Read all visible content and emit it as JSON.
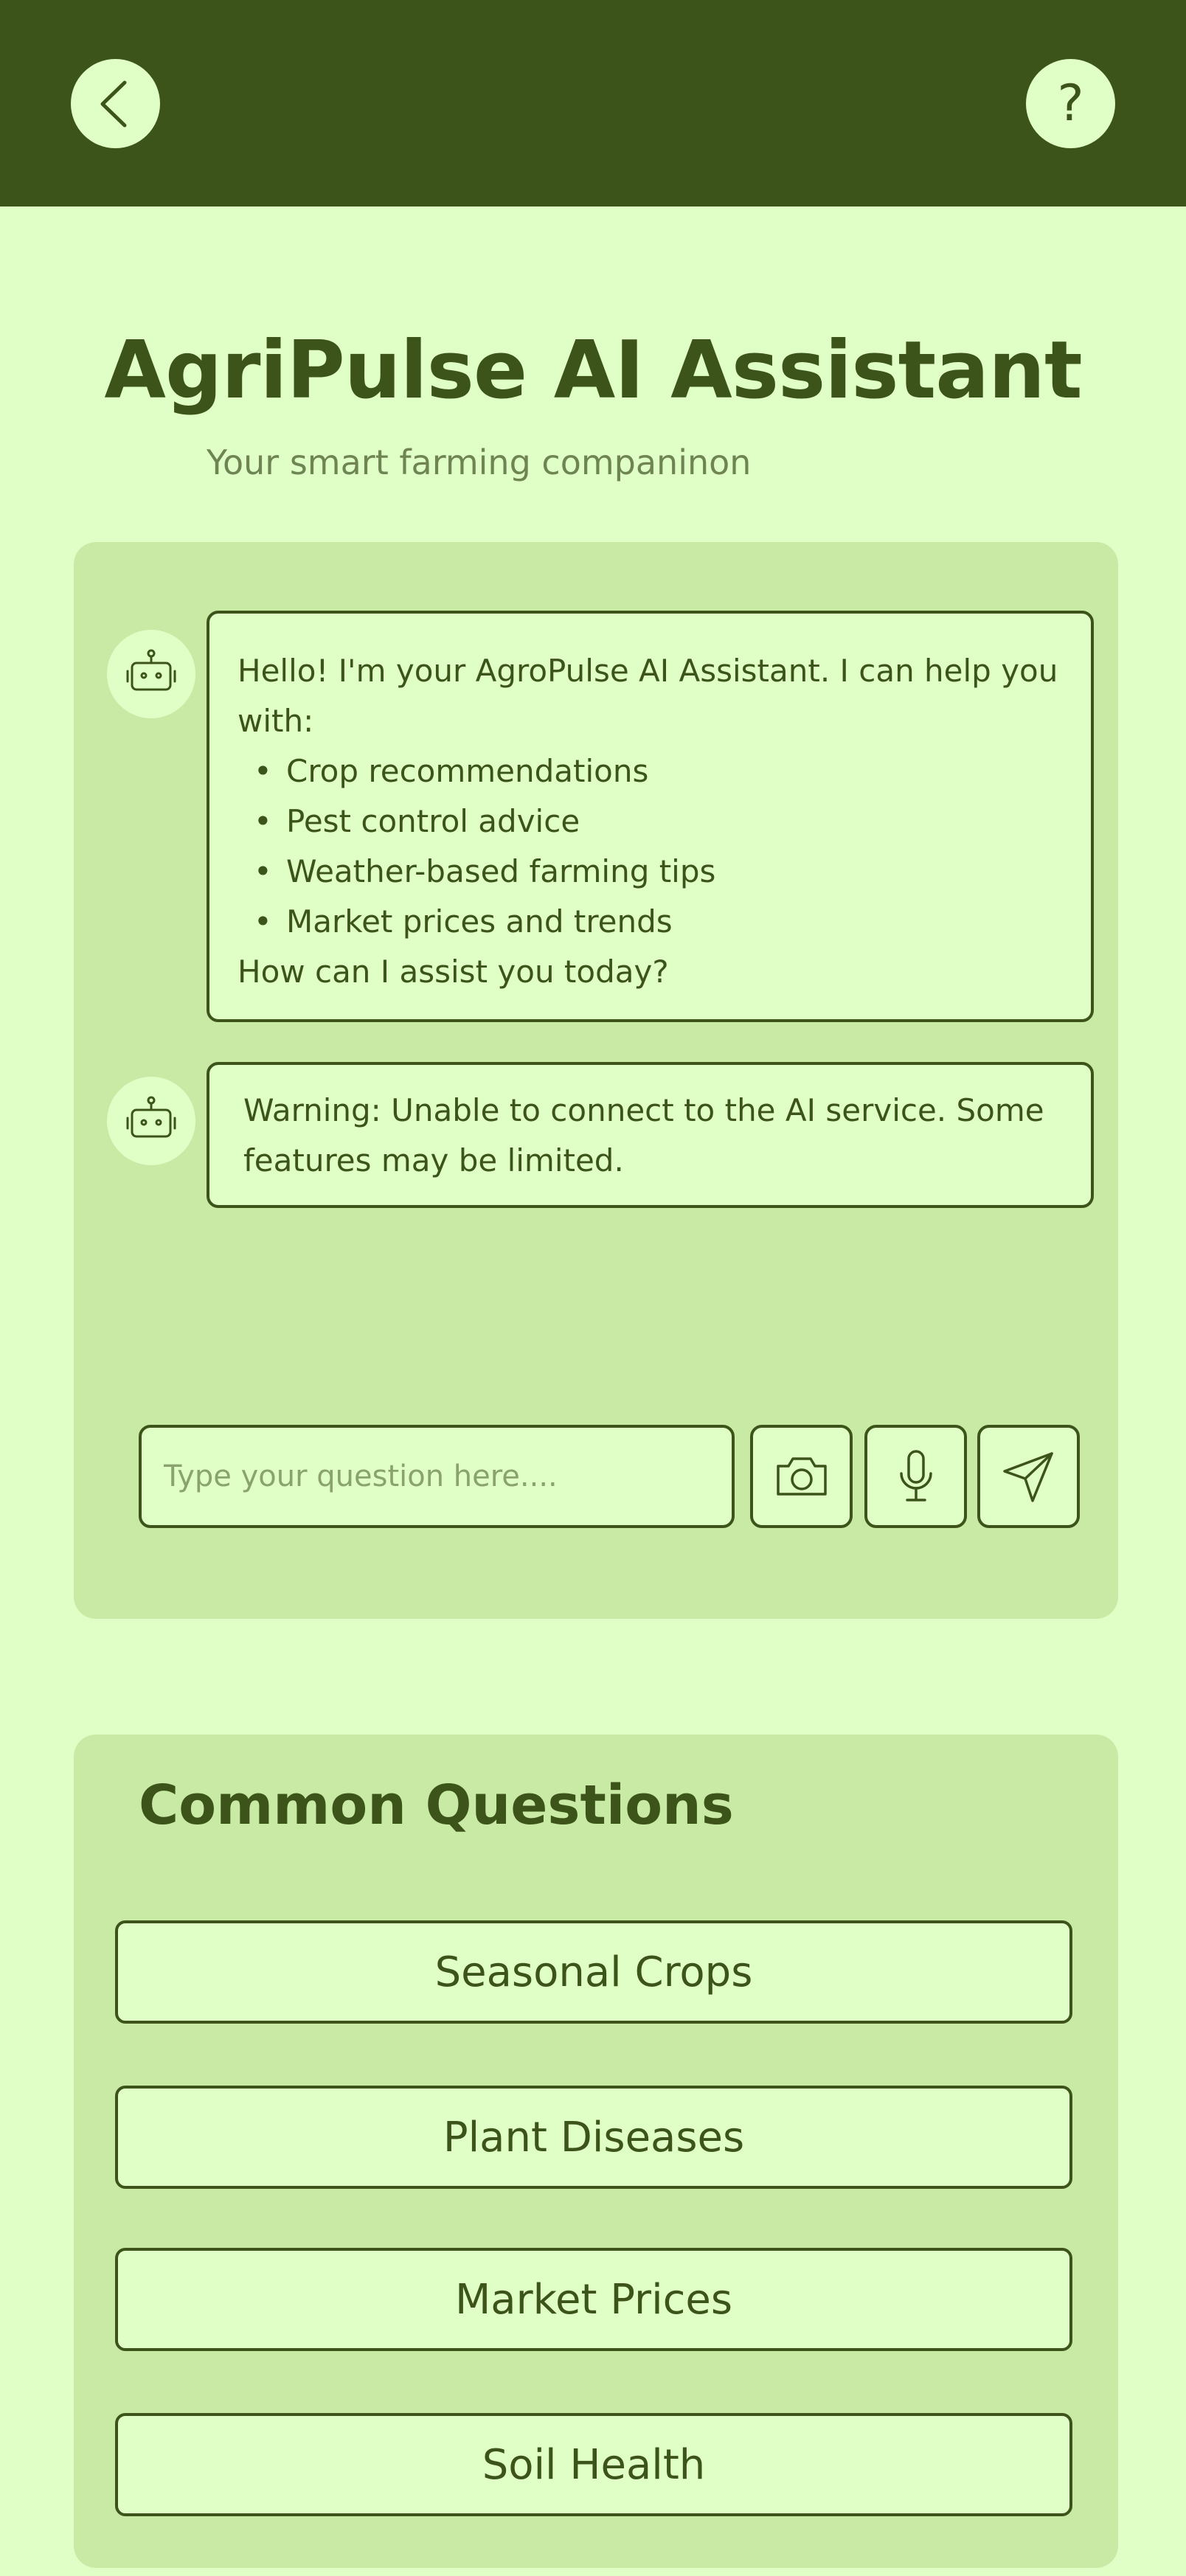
{
  "header": {
    "back_icon": "chevron-left-icon",
    "help_label": "?"
  },
  "hero": {
    "title": "AgriPulse AI Assistant",
    "subtitle": "Your smart farming companinon"
  },
  "chat": {
    "messages": [
      {
        "sender_icon": "robot-icon",
        "intro": "Hello! I'm your AgroPulse AI Assistant. I can help you with:",
        "items": [
          "Crop recommendations",
          "Pest control advice",
          "Weather-based farming tips",
          "Market prices and trends"
        ],
        "outro": "How can I assist you today?"
      },
      {
        "sender_icon": "robot-icon",
        "text": "Warning: Unable to connect to the AI service. Some features may be limited."
      }
    ],
    "input": {
      "placeholder": "Type your question here....",
      "value": ""
    },
    "actions": [
      "camera-icon",
      "microphone-icon",
      "send-icon"
    ]
  },
  "common_questions": {
    "title": "Common Questions",
    "items": [
      "Seasonal Crops",
      "Plant Diseases",
      "Market Prices",
      "Soil Health"
    ]
  },
  "colors": {
    "background": "#e0ffc6",
    "header": "#3c5419",
    "card": "#c9eaa5",
    "text": "#3c5419",
    "muted": "#6f8453"
  }
}
